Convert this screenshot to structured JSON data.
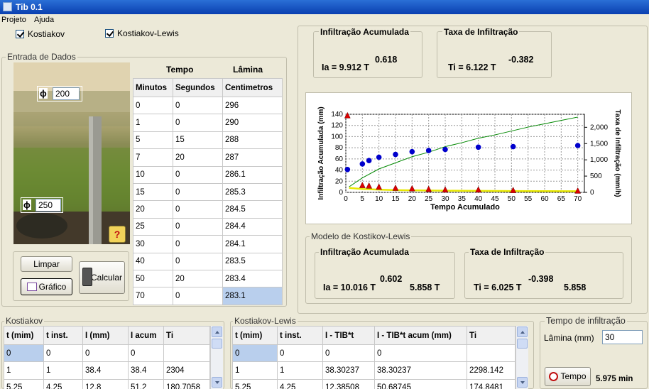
{
  "window": {
    "title": "Tib 0.1"
  },
  "menu": [
    "Projeto",
    "Ajuda"
  ],
  "checkboxes": {
    "kostiakov": "Kostiakov",
    "kostiakov_lewis": "Kostiakov-Lewis"
  },
  "entrada": {
    "group_label": "Entrada de Dados",
    "phi_symbol": "ϕ",
    "phi_top": "200",
    "phi_bottom": "250",
    "help_label": "?"
  },
  "buttons": {
    "limpar": "Limpar",
    "grafico": "Gráfico",
    "calcular": "Calcular",
    "tempo": "Tempo"
  },
  "input_table": {
    "group_headers": [
      "Tempo",
      "Lâmina"
    ],
    "headers": [
      "Minutos",
      "Segundos",
      "Centimetros"
    ],
    "rows": [
      [
        "0",
        "0",
        "296"
      ],
      [
        "1",
        "0",
        "290"
      ],
      [
        "5",
        "15",
        "288"
      ],
      [
        "7",
        "20",
        "287"
      ],
      [
        "10",
        "0",
        "286.1"
      ],
      [
        "15",
        "0",
        "285.3"
      ],
      [
        "20",
        "0",
        "284.5"
      ],
      [
        "25",
        "0",
        "284.4"
      ],
      [
        "30",
        "0",
        "284.1"
      ],
      [
        "40",
        "0",
        "283.5"
      ],
      [
        "50",
        "20",
        "283.4"
      ],
      [
        "70",
        "0",
        "283.1"
      ]
    ]
  },
  "kostiakov_eq": {
    "title_a": "Infiltração Acumulada",
    "ia_left": "Ia = 9.912 T",
    "ia_exp": "0.618",
    "title_t": "Taxa de Infiltração",
    "ti_left": "Ti = 6.122 T",
    "ti_exp": "-0.382"
  },
  "lewis_model": {
    "group_label": "Modelo de Kostikov-Lewis",
    "title_a": "Infiltração Acumulada",
    "ia_left": "Ia = 10.016 T",
    "ia_exp": "0.602",
    "ia_right": "5.858 T",
    "title_t": "Taxa de Infiltração",
    "ti_left": "Ti = 6.025 T",
    "ti_exp": "-0.398",
    "ti_right": "5.858"
  },
  "chart_data": {
    "type": "scatter",
    "xlabel": "Tempo Acumulado",
    "ylabel": "Infiltração Acumulada (mm)",
    "y2label": "Taxa de Infiltração (mm/h)",
    "x_ticks": [
      "0",
      "5",
      "10",
      "15",
      "20",
      "25",
      "30",
      "35",
      "40",
      "45",
      "50",
      "55",
      "60",
      "65",
      "70"
    ],
    "y_ticks": [
      "0",
      "20",
      "40",
      "60",
      "80",
      "100",
      "120",
      "140"
    ],
    "y2_ticks": [
      "0",
      "500",
      "1,000",
      "1,500",
      "2,000"
    ],
    "xlim": [
      0,
      72
    ],
    "ylim": [
      0,
      140
    ],
    "y2lim": [
      0,
      2400
    ],
    "grid": true,
    "series": [
      {
        "marker": "circle",
        "color": "#0000cc",
        "x": [
          0.5,
          5,
          7,
          10,
          15,
          20,
          25,
          30,
          40,
          50.5,
          70
        ],
        "y": [
          41,
          51,
          57,
          63,
          68,
          73,
          75,
          77,
          81,
          82,
          84
        ]
      },
      {
        "marker": "triangle",
        "color": "#dd0000",
        "x": [
          0.5,
          5,
          7,
          10,
          15,
          20,
          25,
          30,
          40,
          50.5,
          70
        ],
        "y": [
          137,
          12,
          11,
          9,
          7,
          6,
          5,
          4,
          4,
          3,
          2
        ]
      },
      {
        "marker": "line",
        "color": "#008800",
        "x": [
          1,
          5,
          10,
          15,
          20,
          25,
          30,
          35,
          40,
          45,
          50,
          55,
          60,
          65,
          70
        ],
        "y": [
          10,
          26,
          42,
          53,
          64,
          72,
          82,
          89,
          97,
          103,
          110,
          117,
          123,
          129,
          135
        ]
      },
      {
        "marker": "line",
        "color": "#e8e800",
        "x": [
          1,
          5,
          10,
          15,
          20,
          25,
          30,
          40,
          50,
          60,
          70
        ],
        "y": [
          8,
          6,
          5,
          4,
          3.6,
          3.3,
          3,
          2.7,
          2.4,
          2.2,
          2
        ]
      }
    ]
  },
  "kostiakov_table": {
    "group_label": "Kostiakov",
    "headers": [
      "t (mim)",
      "t inst.",
      "I (mm)",
      "I acum",
      "Ti"
    ],
    "rows": [
      [
        "0",
        "0",
        "0",
        "0",
        ""
      ],
      [
        "1",
        "1",
        "38.4",
        "38.4",
        "2304"
      ],
      [
        "5.25",
        "4.25",
        "12.8",
        "51.2",
        "180.7058"
      ]
    ]
  },
  "lewis_table": {
    "group_label": "Kostiakov-Lewis",
    "headers": [
      "t (mim)",
      "t inst.",
      "I - TIB*t",
      "I - TIB*t acum (mm)",
      "Ti"
    ],
    "rows": [
      [
        "0",
        "0",
        "0",
        "0",
        ""
      ],
      [
        "1",
        "1",
        "38.30237",
        "38.30237",
        "2298.142"
      ],
      [
        "5.25",
        "4.25",
        "12.38508",
        "50.68745",
        "174.8481"
      ]
    ]
  },
  "tempo_group": {
    "label": "Tempo de infiltração",
    "lamina_label": "Lâmina (mm)",
    "lamina_value": "30",
    "result": "5.975 min"
  }
}
